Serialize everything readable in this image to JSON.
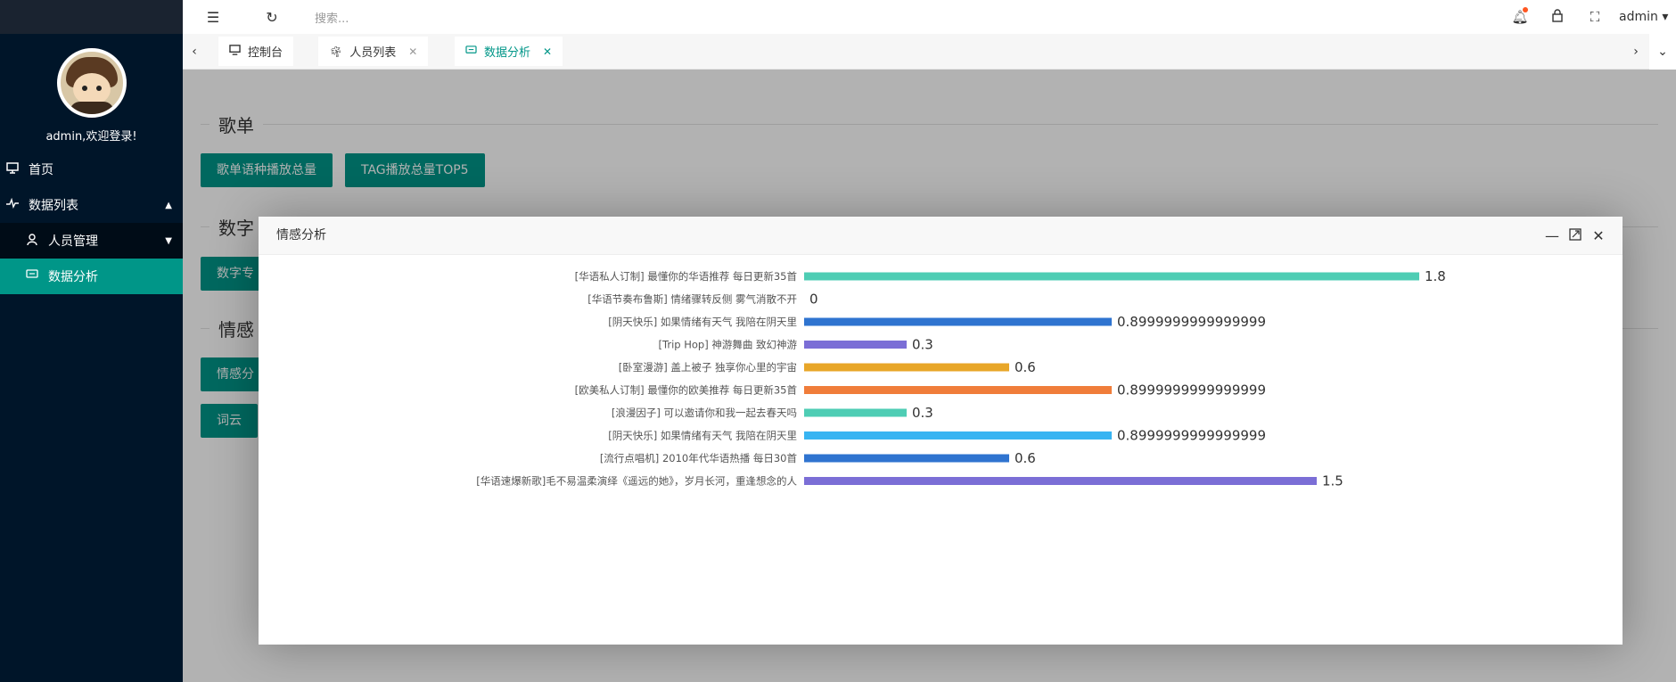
{
  "sidebar": {
    "welcome": "admin,欢迎登录!",
    "items": [
      {
        "label": "首页",
        "icon": "monitor-icon"
      },
      {
        "label": "数据列表",
        "icon": "activity-icon"
      }
    ],
    "sub_items": [
      {
        "label": "人员管理",
        "icon": "user-icon"
      },
      {
        "label": "数据分析",
        "icon": "chat-icon"
      }
    ]
  },
  "topbar": {
    "search_placeholder": "搜索...",
    "user": "admin"
  },
  "tabs": [
    {
      "label": "控制台",
      "icon": "monitor-icon"
    },
    {
      "label": "人员列表",
      "icon": "palm-icon"
    },
    {
      "label": "数据分析",
      "icon": "chat-icon"
    }
  ],
  "content": {
    "section1_title": "歌单",
    "btn1": "歌单语种播放总量",
    "btn2": "TAG播放总量TOP5",
    "section2_title": "数字",
    "btn3": "数字专",
    "section3_title": "情感",
    "btn4": "情感分",
    "btn5": "词云"
  },
  "dialog": {
    "title": "情感分析"
  },
  "colors": {
    "accent": "#009688",
    "sidebar_bg": "#001529"
  },
  "chart_data": {
    "type": "bar",
    "orientation": "horizontal",
    "categories": [
      "[华语私人订制] 最懂你的华语推荐 每日更新35首",
      "[华语节奏布鲁斯] 情绪骤转反侧 雾气消散不开",
      "[阴天快乐] 如果情绪有天气 我陪在阴天里",
      "[Trip Hop] 神游舞曲 致幻神游",
      "[卧室漫游] 盖上被子 独享你心里的宇宙",
      "[欧美私人订制] 最懂你的欧美推荐 每日更新35首",
      "[浪漫因子] 可以邀请你和我一起去春天吗",
      "[阴天快乐] 如果情绪有天气 我陪在阴天里",
      "[流行点唱机] 2010年代华语热播 每日30首",
      "[华语速爆新歌]毛不易温柔演绎《遥远的她》，岁月长河，重逢想念的人"
    ],
    "values": [
      1.8,
      0,
      0.8999999999999999,
      0.3,
      0.6,
      0.8999999999999999,
      0.3,
      0.8999999999999999,
      0.6,
      1.5
    ],
    "value_labels": [
      "1.8",
      "0",
      "0.8999999999999999",
      "0.3",
      "0.6",
      "0.8999999999999999",
      "0.3",
      "0.8999999999999999",
      "0.6",
      "1.5"
    ],
    "colors": [
      "#4ecdb4",
      "#4ecdb4",
      "#2f74d0",
      "#7b6ed6",
      "#e8a628",
      "#f07d3a",
      "#4ecdb4",
      "#38b4f2",
      "#2f74d0",
      "#7b6ed6"
    ],
    "xlim": [
      0,
      1.8
    ],
    "grid": false
  }
}
